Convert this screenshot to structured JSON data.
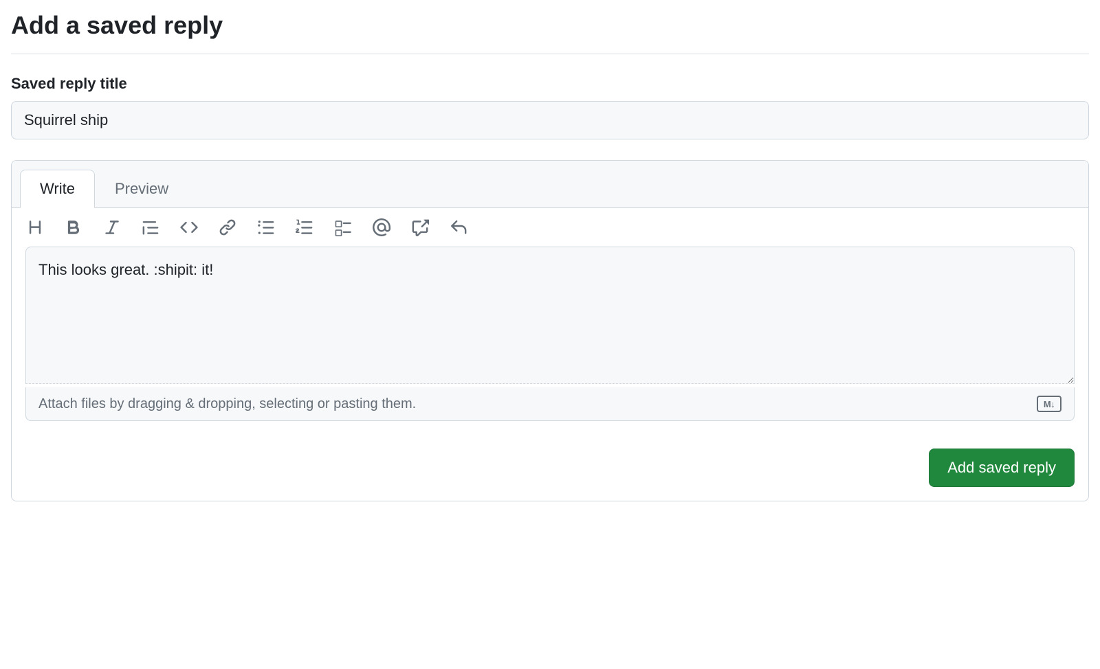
{
  "page": {
    "title": "Add a saved reply",
    "title_label": "Saved reply title",
    "title_value": "Squirrel ship"
  },
  "editor": {
    "tabs": {
      "write": "Write",
      "preview": "Preview"
    },
    "body_value": "This looks great. :shipit: it!",
    "attach_hint": "Attach files by dragging & dropping, selecting or pasting them.",
    "markdown_badge": "M↓"
  },
  "toolbar": {
    "heading": "heading-icon",
    "bold": "bold-icon",
    "italic": "italic-icon",
    "quote": "quote-icon",
    "code": "code-icon",
    "link": "link-icon",
    "ul": "unordered-list-icon",
    "ol": "ordered-list-icon",
    "task": "task-list-icon",
    "mention": "mention-icon",
    "reference": "cross-reference-icon",
    "reply": "reply-icon"
  },
  "actions": {
    "submit": "Add saved reply"
  }
}
